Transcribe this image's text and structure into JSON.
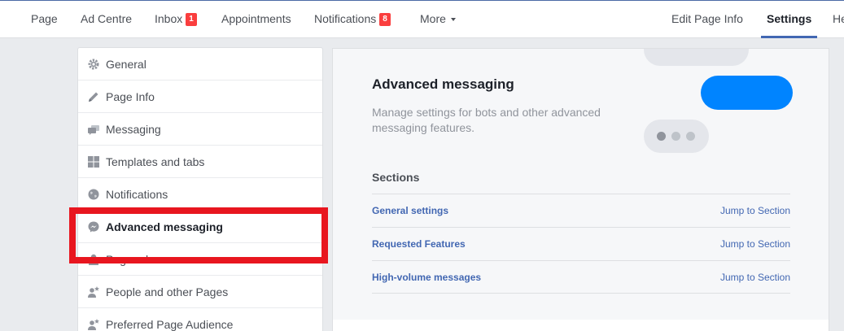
{
  "topnav": {
    "page": "Page",
    "ad_centre": "Ad Centre",
    "inbox": "Inbox",
    "inbox_badge": "1",
    "appointments": "Appointments",
    "notifications": "Notifications",
    "notifications_badge": "8",
    "more": "More",
    "edit_page_info": "Edit Page Info",
    "settings": "Settings",
    "help_partial": "He"
  },
  "sidebar": {
    "items": [
      {
        "label": "General",
        "icon": "gear-icon"
      },
      {
        "label": "Page Info",
        "icon": "pencil-icon"
      },
      {
        "label": "Messaging",
        "icon": "chat-bubbles-icon"
      },
      {
        "label": "Templates and tabs",
        "icon": "grid-icon"
      },
      {
        "label": "Notifications",
        "icon": "globe-icon"
      },
      {
        "label": "Advanced messaging",
        "icon": "messenger-icon",
        "active": true
      },
      {
        "label": "Page roles",
        "icon": "person-icon"
      },
      {
        "label": "People and other Pages",
        "icon": "person-star-icon"
      },
      {
        "label": "Preferred Page Audience",
        "icon": "person-star-icon"
      }
    ]
  },
  "panel": {
    "title": "Advanced messaging",
    "description": "Manage settings for bots and other advanced messaging features.",
    "sections_title": "Sections",
    "sections": [
      {
        "name": "General settings",
        "jump": "Jump to Section"
      },
      {
        "name": "Requested Features",
        "jump": "Jump to Section"
      },
      {
        "name": "High-volume messages",
        "jump": "Jump to Section"
      }
    ]
  },
  "colors": {
    "accent": "#4267b2",
    "messenger_blue": "#0084ff",
    "highlight_red": "#e8161f",
    "badge_red": "#fa3e3e"
  }
}
